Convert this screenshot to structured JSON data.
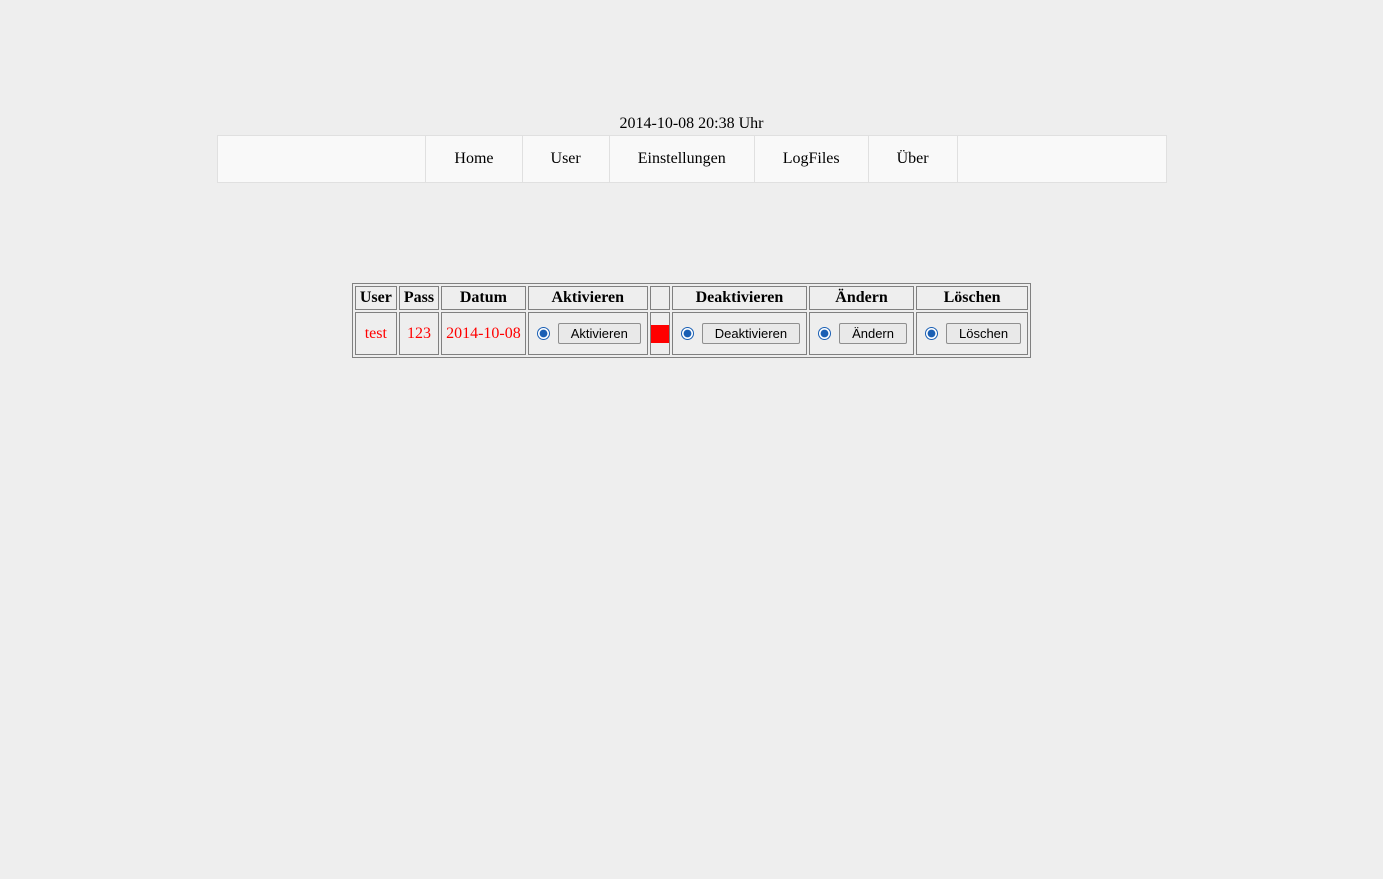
{
  "timestamp": "2014-10-08 20:38 Uhr",
  "nav": {
    "home": "Home",
    "user": "User",
    "settings": "Einstellungen",
    "logfiles": "LogFiles",
    "about": "Über"
  },
  "table": {
    "headers": {
      "user": "User",
      "pass": "Pass",
      "date": "Datum",
      "activate": "Aktivieren",
      "status": "",
      "deactivate": "Deaktivieren",
      "edit": "Ändern",
      "delete": "Löschen"
    },
    "rows": [
      {
        "user": "test",
        "pass": "123",
        "date": "2014-10-08",
        "activate_btn": "Aktivieren",
        "deactivate_btn": "Deaktivieren",
        "edit_btn": "Ändern",
        "delete_btn": "Löschen",
        "status_color": "#ff0000"
      }
    ]
  }
}
